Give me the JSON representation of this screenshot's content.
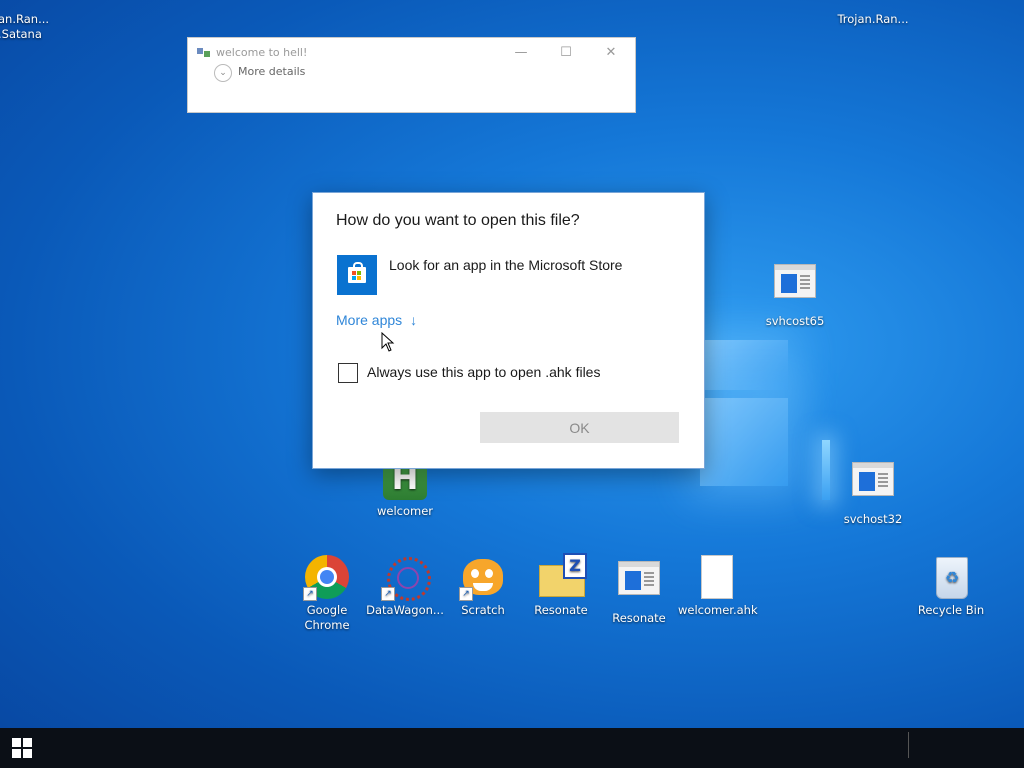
{
  "desktop": {
    "icons": [
      {
        "id": "trojan-left",
        "label": "an.Ran...\n.Satana"
      },
      {
        "id": "trojan-right",
        "label": "Trojan.Ran..."
      },
      {
        "id": "svchost65",
        "label": "svhcost65"
      },
      {
        "id": "welcomer",
        "label": "welcomer"
      },
      {
        "id": "svchost32",
        "label": "svchost32"
      },
      {
        "id": "chrome",
        "label": "Google Chrome"
      },
      {
        "id": "datawagon",
        "label": "DataWagon..."
      },
      {
        "id": "scratch",
        "label": "Scratch"
      },
      {
        "id": "resonate-folder",
        "label": "Resonate"
      },
      {
        "id": "resonate-app",
        "label": "Resonate"
      },
      {
        "id": "welcomer-ahk",
        "label": "welcomer.ahk"
      },
      {
        "id": "recycle-bin",
        "label": "Recycle Bin"
      }
    ]
  },
  "notification_window": {
    "title": "welcome to hell!",
    "details_label": "More details",
    "minimize_glyph": "—",
    "maximize_glyph": "☐",
    "close_glyph": "✕"
  },
  "open_with_dialog": {
    "heading": "How do you want to open this file?",
    "store_option_label": "Look for an app in the Microsoft Store",
    "more_apps_label": "More apps",
    "more_apps_arrow": "↓",
    "always_use_label": "Always use this app to open .ahk files",
    "always_use_checked": false,
    "ok_label": "OK",
    "ok_enabled": false
  },
  "colors": {
    "accent_link": "#2f86d8",
    "store_tile": "#0a72d0",
    "taskbar": "#0b0f16"
  }
}
